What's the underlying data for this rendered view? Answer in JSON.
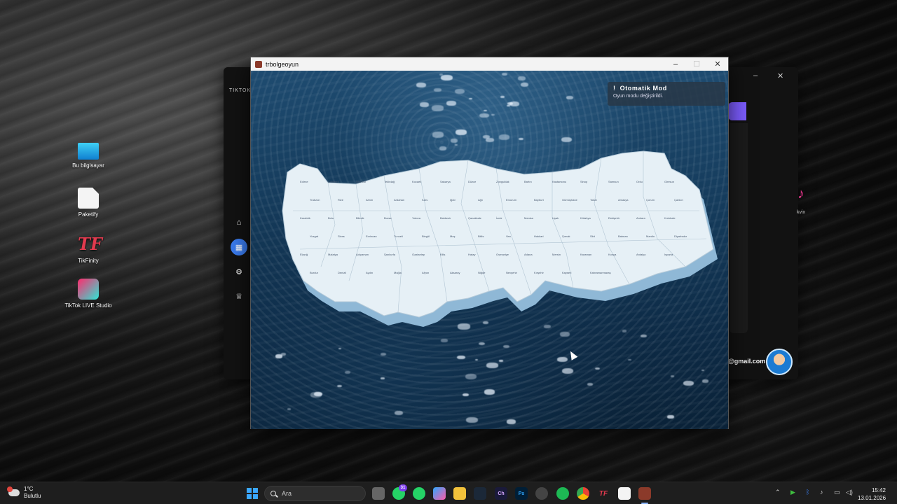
{
  "desktop": {
    "icons": [
      {
        "label": "Bu bilgisayar",
        "icon": "monitor-icon"
      },
      {
        "label": "Paketify",
        "icon": "file-icon"
      },
      {
        "label": "TikFinity",
        "icon": "tikfinity-icon"
      },
      {
        "label": "TikTok LIVE Studio",
        "icon": "tiktok-icon"
      }
    ]
  },
  "bg_app": {
    "logo": "TIKTOK PAKET",
    "email_suffix": "@gmail.com",
    "side_label": "kvix"
  },
  "game": {
    "title": "trbolgeoyun",
    "toast": {
      "title": "Otomatik Mod",
      "message": "Oyun modu değiştirildi."
    },
    "provinces": [
      "Edirne",
      "Kırklareli",
      "İstanbul",
      "Tekirdağ",
      "Kocaeli",
      "Sakarya",
      "Düzce",
      "Zonguldak",
      "Bartın",
      "Kastamonu",
      "Sinop",
      "Samsun",
      "Ordu",
      "Giresun",
      "Trabzon",
      "Rize",
      "Artvin",
      "Ardahan",
      "Kars",
      "Iğdır",
      "Ağrı",
      "Erzurum",
      "Bayburt",
      "Gümüşhane",
      "Tokat",
      "Amasya",
      "Çorum",
      "Çankırı",
      "Karabük",
      "Bolu",
      "Bilecik",
      "Bursa",
      "Yalova",
      "Balıkesir",
      "Çanakkale",
      "İzmir",
      "Manisa",
      "Uşak",
      "Kütahya",
      "Eskişehir",
      "Ankara",
      "Kırıkkale",
      "Yozgat",
      "Sivas",
      "Erzincan",
      "Tunceli",
      "Bingöl",
      "Muş",
      "Bitlis",
      "Van",
      "Hakkari",
      "Şırnak",
      "Siirt",
      "Batman",
      "Mardin",
      "Diyarbakır",
      "Elazığ",
      "Malatya",
      "Adıyaman",
      "Şanlıurfa",
      "Gaziantep",
      "Kilis",
      "Hatay",
      "Osmaniye",
      "Adana",
      "Mersin",
      "Karaman",
      "Konya",
      "Antalya",
      "Isparta",
      "Burdur",
      "Denizli",
      "Aydın",
      "Muğla",
      "Afyon",
      "Aksaray",
      "Niğde",
      "Nevşehir",
      "Kırşehir",
      "Kayseri",
      "Kahramanmaraş"
    ]
  },
  "taskbar": {
    "weather_temp": "1°C",
    "weather_desc": "Bulutlu",
    "search_placeholder": "Ara",
    "time": "15:42",
    "date": "13.01.2026",
    "whatsapp_badge": "31"
  }
}
